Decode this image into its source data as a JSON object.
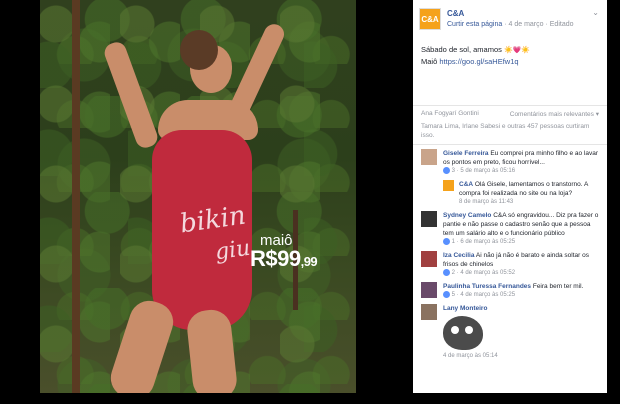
{
  "photo": {
    "suit_text_line1": "bikin",
    "suit_text_line2": "giu",
    "product_label": "maiô",
    "price_main": "R$99",
    "price_cents": ",99"
  },
  "post": {
    "page_name": "C&A",
    "avatar_text": "C&A",
    "meta_action": "Curtir esta página",
    "meta_date": "4 de março",
    "meta_edited": "Editado",
    "text_line1": "Sábado de sol, amamos",
    "emoji": "☀️💗☀️",
    "text_line2_prefix": "Maiô",
    "text_line2_link": "https://goo.gl/saHEfw1q"
  },
  "reactions": {
    "sort_label": "Ana Fogyarí Gontini",
    "sort_option": "Comentários mais relevantes ▾",
    "likes_text": "Tamara Lima, Irlane Sabesi e outras 457 pessoas curtiram isso."
  },
  "comments": [
    {
      "name": "Gisele Ferreira",
      "text": "Eu comprei pra minho filho e ao lavar os pontos em preto, ficou horrível...",
      "meta": "3 · 5 de março às 05:16"
    },
    {
      "reply": true,
      "name": "C&A",
      "text": "Olá Gisele, lamentamos o transtorno. A compra foi realizada no site ou na loja?",
      "meta": "8 de março às 11:43"
    },
    {
      "name": "Sydney Camelo",
      "text": "C&A só engravidou... Diz pra fazer o pantie e não passe o cadastro senão que a pessoa tem um salário alto e o funcionário público",
      "meta": "1 · 6 de março às 05:25"
    },
    {
      "name": "Iza Cecilia",
      "text": "Ai não já não é barato e ainda soltar os frisos de chinelos",
      "meta": "2 · 4 de março às 05:52"
    },
    {
      "name": "Paulinha Turessa Fernandes",
      "text": "Feira bem ter mil.",
      "meta": "5 · 4 de março às 05:25"
    },
    {
      "name": "Lany Monteiro",
      "text": "",
      "meta": "4 de março às 05:14",
      "sticker": true
    }
  ]
}
